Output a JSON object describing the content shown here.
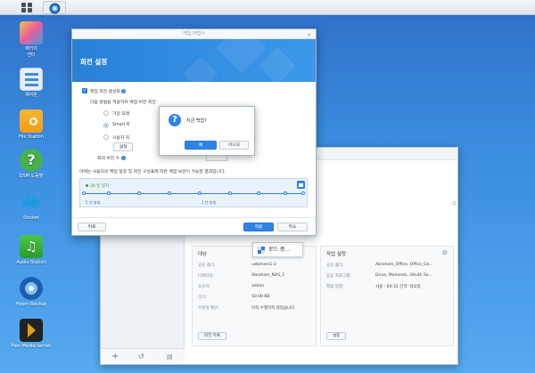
{
  "desktop": {
    "icons": [
      {
        "label_line1": "패키지",
        "label_line2": "센터",
        "icon": "package-center-icon"
      },
      {
        "label_line1": "제어판",
        "label_line2": "",
        "icon": "control-panel-icon"
      },
      {
        "label_line1": "File Station",
        "label_line2": "",
        "icon": "file-station-icon"
      },
      {
        "label_line1": "DSM 도움말",
        "label_line2": "",
        "icon": "help-icon"
      },
      {
        "label_line1": "Docker",
        "label_line2": "",
        "icon": "docker-icon"
      },
      {
        "label_line1": "Audio Station",
        "label_line2": "",
        "icon": "audio-station-icon"
      },
      {
        "label_line1": "Hyper Backup",
        "label_line2": "",
        "icon": "hyper-backup-icon"
      },
      {
        "label_line1": "Plex Media Server",
        "label_line2": "",
        "icon": "plex-icon"
      }
    ]
  },
  "wizard": {
    "window_title": "백업 마법사",
    "header_title": "회전 설정",
    "enable_rotation_label": "백업 회전 활성화",
    "method_prompt": "다음 방법을 적용하여 백업 버전 회전",
    "radio_1": "가장 오래",
    "radio_2": "Smart R",
    "radio_3": "사용자 지",
    "settings_button": "설정",
    "max_versions_label": "최대 버전 수",
    "timeline_caption": "아래는 사용자의 백업 일정 및 회전 구성표에 따른 백업 보관이 가능한 결과입니다:",
    "timeline_green": "30 일 길치",
    "timeline_left_label": "5 년 설재",
    "timeline_right_label": "1 년 설재",
    "footer_prev": "뒤로",
    "footer_apply": "적용",
    "footer_cancel": "취소"
  },
  "confirm_dialog": {
    "message": "지금 백업?",
    "yes": "예",
    "no": "아니오"
  },
  "loading": {
    "text": "로드 중..."
  },
  "back_window": {
    "target_panel": {
      "title": "대상",
      "rows": [
        {
          "k": "공유 폴더:",
          "v": "usbshare1-2"
        },
        {
          "k": "디렉터리:",
          "v": "Abraham_NAS_1"
        },
        {
          "k": "소유자:",
          "v": "admin"
        },
        {
          "k": "크기:",
          "v": "50.00 KB"
        },
        {
          "k": "무결성 확인:",
          "v": "아직 수행하지 않았습니다"
        }
      ],
      "button": "버전 목록"
    },
    "task_panel": {
      "title": "작업 설정",
      "rows": [
        {
          "k": "공유 폴더:",
          "v": "Abraham_Office, Office_Ge..."
        },
        {
          "k": "응용 프로그램:",
          "v": "Drive, Moments, OAuth Se..."
        },
        {
          "k": "백업 일정:",
          "v": "사용 : 04:32 간격: 일요일"
        }
      ],
      "button": "설정"
    },
    "scroll_hint": ":3"
  },
  "colors": {
    "accent": "#2f83e5",
    "header_blue": "#2a80d8",
    "green": "#27a53a"
  }
}
